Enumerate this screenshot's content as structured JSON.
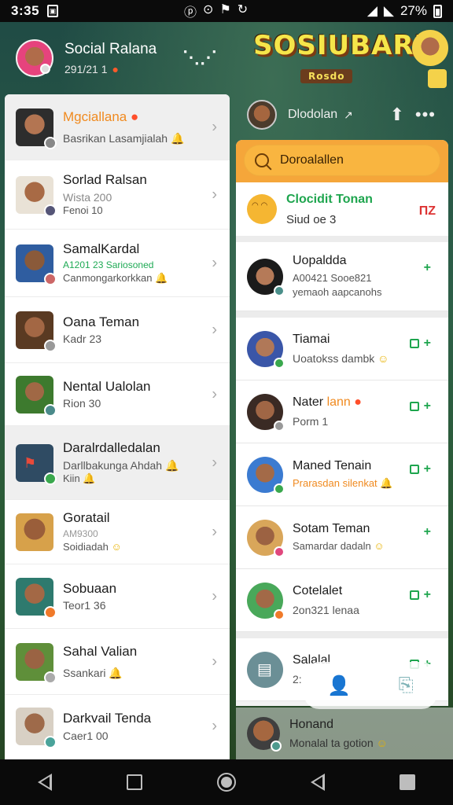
{
  "status_bar": {
    "time": "3:35",
    "battery": "27%"
  },
  "drawer_header": {
    "name": "Social Ralana",
    "sub": "291/21 1"
  },
  "drawer_items": [
    {
      "title": "Mgciallana",
      "subtitle": "Basrikan Lasamjialah",
      "extra": "",
      "selected": true,
      "title_color": "orange"
    },
    {
      "title": "Sorlad Ralsan",
      "subtitle": "Wista 200",
      "extra": "Fenoi 10",
      "selected": false
    },
    {
      "title": "SamalKardal",
      "subtitle": "A1201 23 Sariosoned",
      "extra": "Canmongarkorkkan",
      "selected": false
    },
    {
      "title": "Oana Teman",
      "subtitle": "Kadr 23",
      "extra": "",
      "selected": false
    },
    {
      "title": "Nental Ualolan",
      "subtitle": "Rion 30",
      "extra": "",
      "selected": false
    },
    {
      "title": "Daralrdalledalan",
      "subtitle": "Darllbakunga Ahdah",
      "extra": "Kiin",
      "selected": true
    },
    {
      "title": "Goratail",
      "subtitle": "AM9300",
      "extra": "Soidiadah",
      "selected": false
    },
    {
      "title": "Sobuaan",
      "subtitle": "Teor1 36",
      "extra": "",
      "selected": false
    },
    {
      "title": "Sahal Valian",
      "subtitle": "Ssankari",
      "extra": "",
      "selected": false
    },
    {
      "title": "Darkvail Tenda",
      "subtitle": "Caer1 00",
      "extra": "",
      "selected": false
    }
  ],
  "game": {
    "logo": "SOSIUBARI",
    "sign": "Rosdo"
  },
  "right_header": {
    "name": "Dlodolan"
  },
  "search": {
    "placeholder": "Doroalallen"
  },
  "highlight": {
    "title": "Clocidit Tonan",
    "subtitle": "Siud oe 3",
    "flag": "ПZ"
  },
  "right_items": [
    {
      "title": "Uopaldda",
      "subtitle": "A00421 Sooe821",
      "extra": "yemaoh aapcanohs"
    },
    {
      "title": "Tiamai",
      "subtitle": "Uoatokss dambk",
      "extra": ""
    },
    {
      "title": "Nater",
      "title_accent": "lann",
      "subtitle": "Porm 1",
      "extra": ""
    },
    {
      "title": "Maned Tenain",
      "subtitle": "Prarasdan silenkat",
      "extra": "",
      "subtitle_orange": true
    },
    {
      "title": "Sotam Teman",
      "subtitle": "Samardar dadaln",
      "extra": ""
    },
    {
      "title": "Cotelalet",
      "subtitle": "2on321 lenaa",
      "extra": ""
    },
    {
      "title": "Salalal",
      "subtitle": "2:",
      "extra": ""
    }
  ],
  "peek_item": {
    "title": "Honand",
    "subtitle": "Monalal ta gotion"
  },
  "colors": {
    "accent_orange": "#f5a63a",
    "accent_green": "#1ea54e",
    "title_orange": "#f08a1f"
  }
}
